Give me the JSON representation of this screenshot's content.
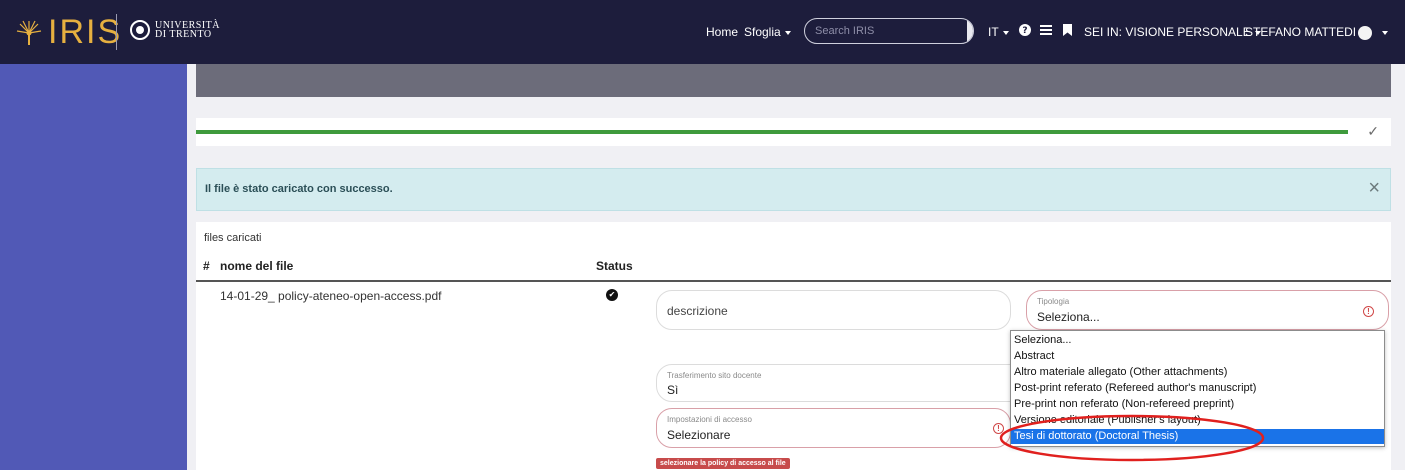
{
  "brand": {
    "logo_text": "IRIS",
    "university_line1": "UNIVERSITÀ",
    "university_line2": "DI TRENTO"
  },
  "nav": {
    "home": "Home",
    "browse": "Sfoglia",
    "search_placeholder": "Search IRIS",
    "language": "IT",
    "context": "SEI IN: VISIONE PERSONALE",
    "user": "STEFANO MATTEDI"
  },
  "progress": {
    "fraction": 1.0,
    "check": "✓"
  },
  "alert": {
    "message": "Il file è stato caricato con successo.",
    "close": "×"
  },
  "files": {
    "title": "files caricati",
    "columns": {
      "index": "#",
      "name": "nome del file",
      "status": "Status"
    },
    "rows": [
      {
        "name": "14-01-29_ policy-ateneo-open-access.pdf",
        "status": "ok"
      }
    ]
  },
  "form": {
    "description_placeholder": "descrizione",
    "tipologia": {
      "label": "Tipologia",
      "value": "Seleziona..."
    },
    "transfer": {
      "label": "Trasferimento sito docente",
      "value": "Sì"
    },
    "access": {
      "label": "Impostazioni di accesso",
      "value": "Selezionare"
    },
    "access_error": "selezionare la policy di accesso al file"
  },
  "dropdown": {
    "options": [
      "Seleziona...",
      "Abstract",
      "Altro materiale allegato (Other attachments)",
      "Post-print referato (Refereed author's manuscript)",
      "Pre-print non referato (Non-refereed preprint)",
      "Versione editoriale (Publisher's layout)",
      "Tesi di dottorato (Doctoral Thesis)"
    ],
    "selected_index": 6
  },
  "colors": {
    "navbar": "#1d1d3c",
    "sidebar": "#5159b6",
    "accent": "#1a73e8",
    "progress": "#3e9a3c",
    "error": "#c74b4b",
    "annotation": "#e0201e"
  }
}
